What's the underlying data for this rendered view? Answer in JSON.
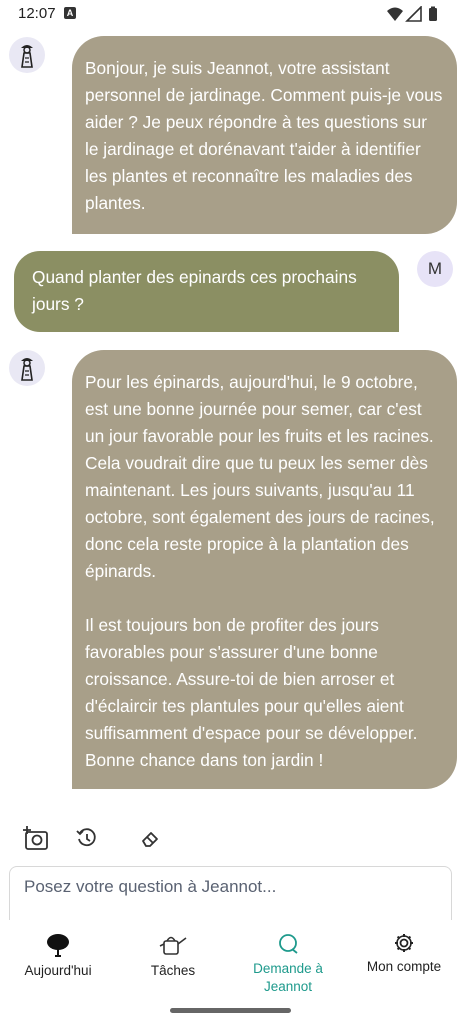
{
  "status_bar": {
    "time": "12:07",
    "notification_glyph": "A"
  },
  "chat": {
    "messages": [
      {
        "sender": "bot",
        "text": "Bonjour, je suis Jeannot, votre assistant personnel de jardinage. Comment puis-je vous aider ? Je peux répondre à tes questions sur le jardinage et dorénavant t'aider à identifier les plantes et reconnaître les maladies des plantes."
      },
      {
        "sender": "user",
        "avatar_initial": "M",
        "text": "Quand planter des epinards ces prochains jours ?"
      },
      {
        "sender": "bot",
        "text": "Pour les épinards, aujourd'hui, le 9 octobre, est une bonne journée pour semer, car c'est un jour favorable pour les fruits et les racines. Cela voudrait dire que tu peux les semer dès maintenant. Les jours suivants, jusqu'au 11 octobre, sont également des jours de racines, donc cela reste propice à la plantation des épinards.\n\nIl est toujours bon de profiter des jours favorables pour s'assurer d'une bonne croissance. Assure-toi de bien arroser et d'éclaircir tes plantules pour qu'elles aient suffisamment d'espace pour se développer. Bonne chance dans ton jardin !"
      }
    ]
  },
  "toolbar": {
    "icons": [
      "add-photo-icon",
      "history-icon",
      "eraser-icon"
    ]
  },
  "input": {
    "placeholder": "Posez votre question à Jeannot..."
  },
  "nav": {
    "items": [
      {
        "label": "Aujourd'hui",
        "icon": "leaf-icon"
      },
      {
        "label": "Tâches",
        "icon": "watering-can-icon"
      },
      {
        "label": "Demande à\nJeannot",
        "icon": "chat-icon",
        "active": true
      },
      {
        "label": "Mon compte",
        "icon": "gear-icon"
      }
    ]
  },
  "colors": {
    "bot_bubble": "#a89f89",
    "user_bubble": "#8b8f63",
    "accent": "#1e9a8c"
  }
}
